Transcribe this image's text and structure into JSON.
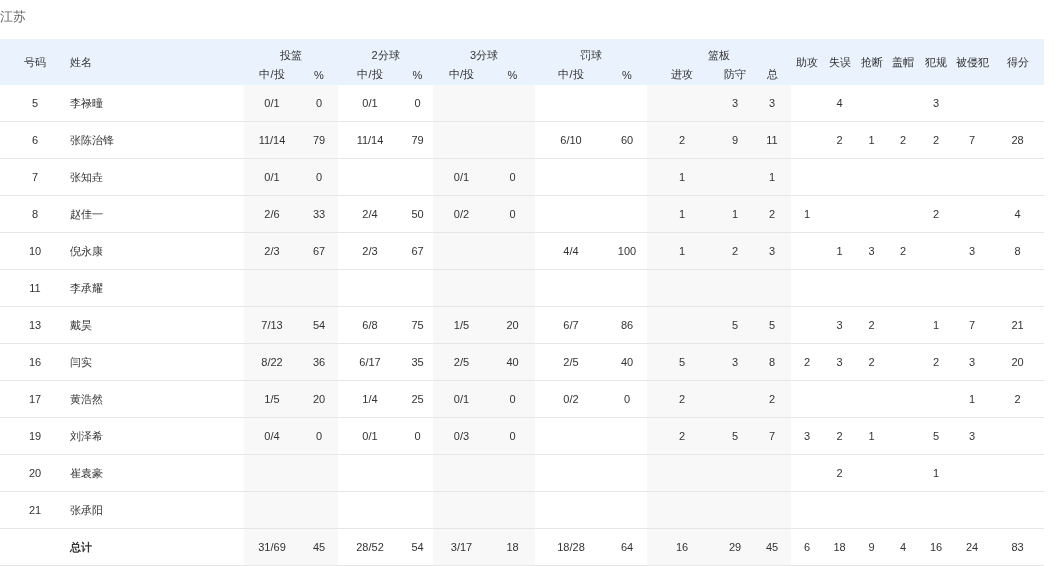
{
  "team": "江苏",
  "table": {
    "columns": [
      {
        "label": "号码"
      },
      {
        "label": "姓名"
      },
      {
        "group": "投篮",
        "subcolumns": [
          "中/投",
          "%"
        ]
      },
      {
        "group": "2分球",
        "subcolumns": [
          "中/投",
          "%"
        ]
      },
      {
        "group": "3分球",
        "subcolumns": [
          "中/投",
          "%"
        ]
      },
      {
        "group": "罚球",
        "subcolumns": [
          "中/投",
          "%"
        ]
      },
      {
        "group": "篮板",
        "subcolumns": [
          "进攻",
          "防守",
          "总"
        ]
      },
      {
        "label": "助攻"
      },
      {
        "label": "失误"
      },
      {
        "label": "抢断"
      },
      {
        "label": "盖帽"
      },
      {
        "label": "犯规"
      },
      {
        "label": "被侵犯"
      },
      {
        "label": "得分"
      }
    ],
    "rows": [
      {
        "number": "5",
        "name": "李禄曈",
        "fg": "0/1",
        "fg_pct": "0",
        "fg2": "0/1",
        "fg2_pct": "0",
        "dreb": "3",
        "reb": "3",
        "tov": "4",
        "pf": "3"
      },
      {
        "number": "6",
        "name": "张陈治锋",
        "fg": "11/14",
        "fg_pct": "79",
        "fg2": "11/14",
        "fg2_pct": "79",
        "ft": "6/10",
        "ft_pct": "60",
        "oreb": "2",
        "dreb": "9",
        "reb": "11",
        "tov": "2",
        "stl": "1",
        "blk": "2",
        "pf": "2",
        "fd": "7",
        "pts": "28"
      },
      {
        "number": "7",
        "name": "张知垚",
        "fg": "0/1",
        "fg_pct": "0",
        "fg3": "0/1",
        "fg3_pct": "0",
        "oreb": "1",
        "reb": "1"
      },
      {
        "number": "8",
        "name": "赵佳一",
        "fg": "2/6",
        "fg_pct": "33",
        "fg2": "2/4",
        "fg2_pct": "50",
        "fg3": "0/2",
        "fg3_pct": "0",
        "oreb": "1",
        "dreb": "1",
        "reb": "2",
        "ast": "1",
        "pf": "2",
        "pts": "4"
      },
      {
        "number": "10",
        "name": "倪永康",
        "fg": "2/3",
        "fg_pct": "67",
        "fg2": "2/3",
        "fg2_pct": "67",
        "ft": "4/4",
        "ft_pct": "100",
        "oreb": "1",
        "dreb": "2",
        "reb": "3",
        "tov": "1",
        "stl": "3",
        "blk": "2",
        "fd": "3",
        "pts": "8"
      },
      {
        "number": "11",
        "name": "李承耀"
      },
      {
        "number": "13",
        "name": "戴昊",
        "fg": "7/13",
        "fg_pct": "54",
        "fg2": "6/8",
        "fg2_pct": "75",
        "fg3": "1/5",
        "fg3_pct": "20",
        "ft": "6/7",
        "ft_pct": "86",
        "dreb": "5",
        "reb": "5",
        "tov": "3",
        "stl": "2",
        "pf": "1",
        "fd": "7",
        "pts": "21"
      },
      {
        "number": "16",
        "name": "闫实",
        "fg": "8/22",
        "fg_pct": "36",
        "fg2": "6/17",
        "fg2_pct": "35",
        "fg3": "2/5",
        "fg3_pct": "40",
        "ft": "2/5",
        "ft_pct": "40",
        "oreb": "5",
        "dreb": "3",
        "reb": "8",
        "ast": "2",
        "tov": "3",
        "stl": "2",
        "pf": "2",
        "fd": "3",
        "pts": "20"
      },
      {
        "number": "17",
        "name": "黄浩然",
        "fg": "1/5",
        "fg_pct": "20",
        "fg2": "1/4",
        "fg2_pct": "25",
        "fg3": "0/1",
        "fg3_pct": "0",
        "ft": "0/2",
        "ft_pct": "0",
        "oreb": "2",
        "reb": "2",
        "fd": "1",
        "pts": "2"
      },
      {
        "number": "19",
        "name": "刘泽希",
        "fg": "0/4",
        "fg_pct": "0",
        "fg2": "0/1",
        "fg2_pct": "0",
        "fg3": "0/3",
        "fg3_pct": "0",
        "oreb": "2",
        "dreb": "5",
        "reb": "7",
        "ast": "3",
        "tov": "2",
        "stl": "1",
        "pf": "5",
        "fd": "3"
      },
      {
        "number": "20",
        "name": "崔袁豪",
        "tov": "2",
        "pf": "1"
      },
      {
        "number": "21",
        "name": "张承阳"
      }
    ],
    "total": {
      "name": "总计",
      "fg": "31/69",
      "fg_pct": "45",
      "fg2": "28/52",
      "fg2_pct": "54",
      "fg3": "3/17",
      "fg3_pct": "18",
      "ft": "18/28",
      "ft_pct": "64",
      "oreb": "16",
      "dreb": "29",
      "reb": "45",
      "ast": "6",
      "tov": "18",
      "stl": "9",
      "blk": "4",
      "pf": "16",
      "fd": "24",
      "pts": "83"
    }
  }
}
